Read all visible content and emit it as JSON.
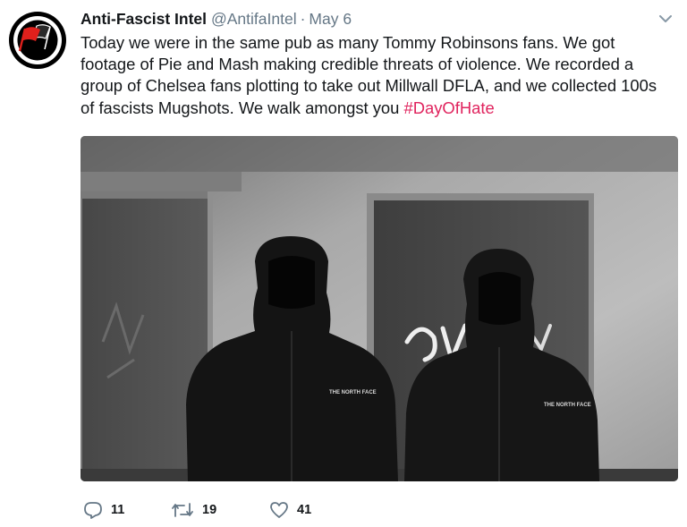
{
  "tweet": {
    "display_name": "Anti-Fascist Intel",
    "handle": "@AntifaIntel",
    "separator": "·",
    "date": "May 6",
    "text_plain": "Today we were in the same pub as many Tommy Robinsons fans. We got footage of Pie and Mash making credible threats of violence. We recorded a group of Chelsea fans plotting to take out Millwall DFLA, and we collected 100s of fascists Mugshots. We walk amongst you ",
    "hashtag": "#DayOfHate",
    "avatar_icon": "antifa-flag-icon",
    "menu_icon": "chevron-down-icon",
    "media_text": {
      "jacket_logo_left": "THE NORTH FACE",
      "jacket_logo_right": "THE NORTH FACE"
    }
  },
  "actions": {
    "reply": {
      "icon": "reply-icon",
      "count": "11"
    },
    "retweet": {
      "icon": "retweet-icon",
      "count": "19"
    },
    "like": {
      "icon": "heart-icon",
      "count": "41"
    }
  },
  "colors": {
    "text": "#14171a",
    "secondary": "#657786",
    "hashtag": "#e0245e",
    "avatar_bg": "#000000",
    "flag_red": "#e0201c"
  }
}
